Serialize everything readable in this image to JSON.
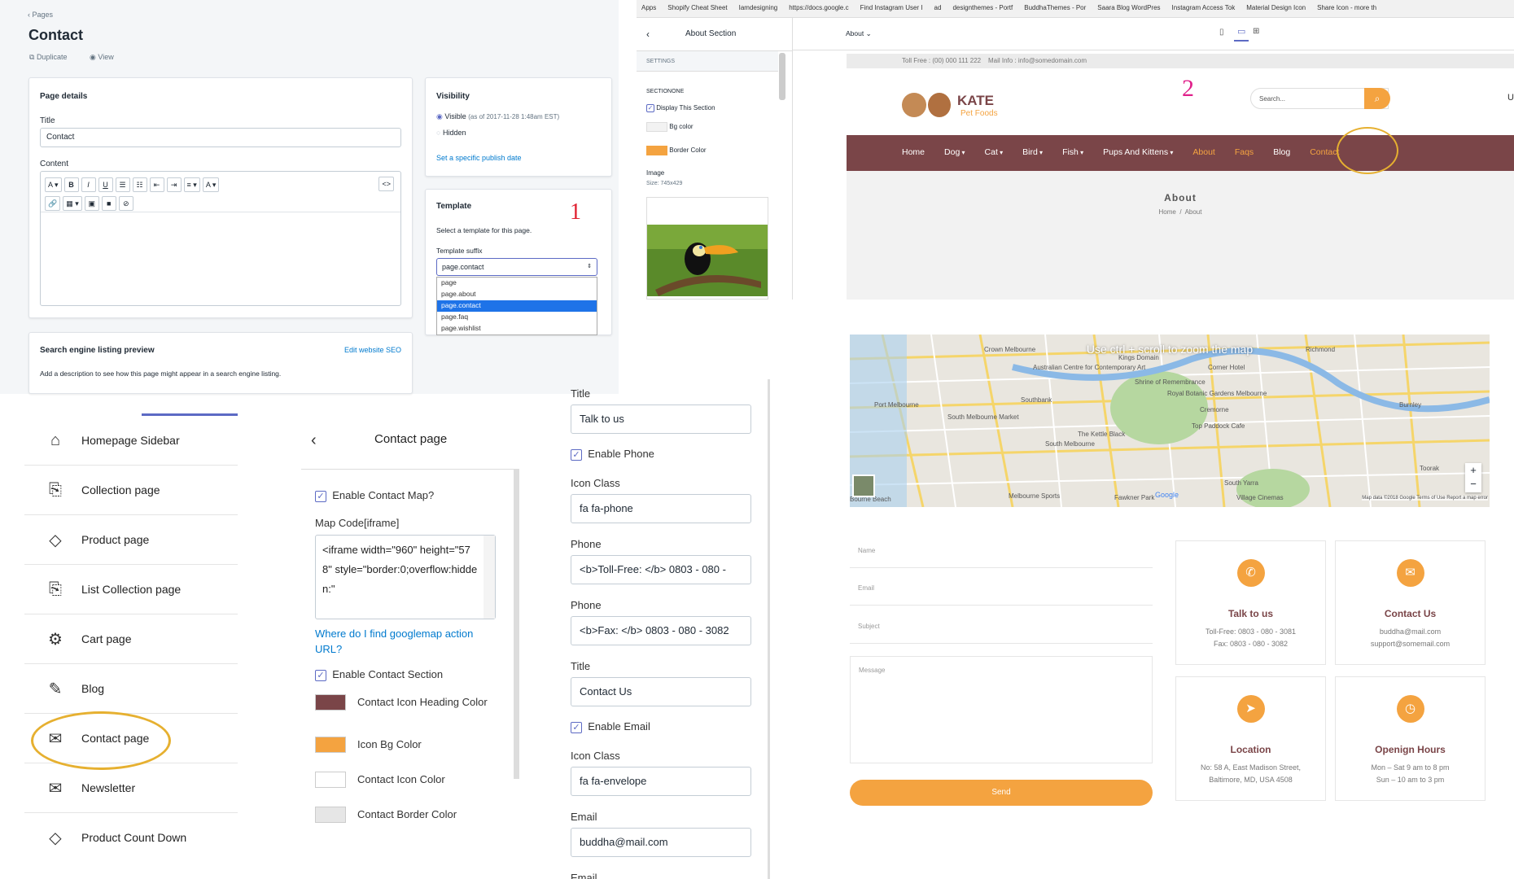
{
  "admin": {
    "breadcrumb": "Pages",
    "page_title": "Contact",
    "actions": {
      "duplicate": "Duplicate",
      "view": "View"
    },
    "page_details": {
      "heading": "Page details",
      "title_label": "Title",
      "title_value": "Contact",
      "content_label": "Content"
    },
    "visibility": {
      "heading": "Visibility",
      "visible": "Visible",
      "visible_note": "(as of 2017-11-28 1:48am EST)",
      "hidden": "Hidden",
      "publish_link": "Set a specific publish date"
    },
    "template": {
      "heading": "Template",
      "description": "Select a template for this page.",
      "suffix_label": "Template suffix",
      "selected": "page.contact",
      "options": [
        "page",
        "page.about",
        "page.contact",
        "page.faq",
        "page.wishlist"
      ]
    },
    "annotation": "1",
    "seo": {
      "heading": "Search engine listing preview",
      "edit_link": "Edit website SEO",
      "description": "Add a description to see how this page might appear in a search engine listing."
    }
  },
  "browser": {
    "bookmarks": [
      "Apps",
      "Shopify Cheat Sheet",
      "Iamdesigning",
      "https://docs.google.c",
      "Find Instagram User I",
      "ad",
      "designthemes - Portf",
      "BuddhaThemes - Por",
      "Saara Blog WordPres",
      "Instagram Access Tok",
      "Material Design Icon",
      "Share Icon - more th"
    ]
  },
  "theme_editor": {
    "section_title": "About Section",
    "page_select": "About",
    "settings_label": "SETTINGS",
    "section_name": "SECTIONONE",
    "display_section": "Display This Section",
    "bg_color": "Bg color",
    "border_color": "Border Color",
    "image_label": "Image",
    "image_size": "Size: 745x429",
    "colors": {
      "border": "#f4a340",
      "bg": "#f2f2f2"
    }
  },
  "storefront": {
    "topbar": "Toll Free : (00) 000 111 222    Mail Info : info@somedomain.com",
    "logo_main": "KATE",
    "logo_sub": "Pet Foods",
    "search_placeholder": "Search...",
    "cut_letter": "U",
    "annotation": "2",
    "nav": [
      "Home",
      "Dog",
      "Cat",
      "Bird",
      "Fish",
      "Pups And Kittens",
      "About",
      "Faqs",
      "Blog",
      "Contact"
    ],
    "nav_dropdown": [
      false,
      true,
      true,
      true,
      true,
      true,
      false,
      false,
      false,
      false
    ],
    "heading": "About",
    "breadcrumb_home": "Home",
    "breadcrumb_sep": "/",
    "breadcrumb_current": "About",
    "colors": {
      "nav": "#7a4548",
      "accent": "#f4a340"
    }
  },
  "sidebar": {
    "items": [
      {
        "label": "Homepage Sidebar",
        "icon": "home-icon"
      },
      {
        "label": "Collection page",
        "icon": "collection-icon"
      },
      {
        "label": "Product page",
        "icon": "tag-icon"
      },
      {
        "label": "List Collection page",
        "icon": "collection-icon"
      },
      {
        "label": "Cart page",
        "icon": "gear-icon"
      },
      {
        "label": "Blog",
        "icon": "edit-icon"
      },
      {
        "label": "Contact page",
        "icon": "mail-icon"
      },
      {
        "label": "Newsletter",
        "icon": "mail-icon"
      },
      {
        "label": "Product Count Down",
        "icon": "tag-icon"
      }
    ]
  },
  "contact_settings": {
    "title": "Contact page",
    "enable_map": "Enable Contact Map?",
    "map_code_label": "Map Code[iframe]",
    "map_code_value": "<iframe width=\"960\" height=\"578\" style=\"border:0;overflow:hidden:\"",
    "help_link": "Where do I find googlemap action URL?",
    "enable_section": "Enable Contact Section",
    "colors": [
      {
        "label": "Contact Icon Heading Color",
        "value": "#7a4548"
      },
      {
        "label": "Icon Bg Color",
        "value": "#f4a340"
      },
      {
        "label": "Contact Icon Color",
        "value": "#ffffff"
      },
      {
        "label": "Contact Border Color",
        "value": "#e6e6e6"
      }
    ]
  },
  "contact_fields": {
    "title_label": "Title",
    "title1": "Talk to us",
    "enable_phone": "Enable Phone",
    "icon_class_label": "Icon Class",
    "icon_phone": "fa fa-phone",
    "phone_label": "Phone",
    "phone1": "<b>Toll-Free: </b> 0803 - 080 - ",
    "phone2": "<b>Fax: </b> 0803 - 080 - 3082",
    "title2": "Contact Us",
    "enable_email": "Enable Email",
    "icon_email": "fa fa-envelope",
    "email_label": "Email",
    "email1": "buddha@mail.com",
    "email2_label": "Email"
  },
  "map": {
    "overlay": "Use ctrl + scroll to zoom the map",
    "places": [
      "Richmond",
      "Southbank",
      "South Melbourne Market",
      "Port Melbourne",
      "Cremorne",
      "South Yarra",
      "Burnley",
      "Toorak",
      "Melbourne Sports",
      "Kings Domain",
      "Royal Botanic Gardens Melbourne",
      "Shrine of Remembrance",
      "Australian Centre for Contemporary Art",
      "Crown Melbourne",
      "The Kettle Black",
      "Top Paddock Cafe",
      "Corner Hotel",
      "Fawkner Park",
      "Village Cinemas",
      "South Melbourne",
      "Bourne Beach"
    ],
    "attribution": "Map data ©2018 Google  Terms of Use  Report a map error",
    "google": "Google",
    "zoom_in": "+",
    "zoom_out": "−"
  },
  "contact_form": {
    "name": "Name",
    "email": "Email",
    "subject": "Subject",
    "message": "Message",
    "send": "Send"
  },
  "contact_cards": [
    {
      "title": "Talk to us",
      "lines": [
        "Toll-Free: 0803 - 080 - 3081",
        "Fax: 0803 - 080 - 3082"
      ],
      "icon": "phone-icon"
    },
    {
      "title": "Contact Us",
      "lines": [
        "buddha@mail.com",
        "support@somemail.com"
      ],
      "icon": "envelope-icon"
    },
    {
      "title": "Location",
      "lines": [
        "No: 58 A, East Madison Street,",
        "Baltimore, MD, USA 4508"
      ],
      "icon": "location-arrow-icon"
    },
    {
      "title": "Openign Hours",
      "lines": [
        "Mon – Sat 9 am to 8 pm",
        "Sun – 10 am to 3 pm"
      ],
      "icon": "clock-icon"
    }
  ]
}
